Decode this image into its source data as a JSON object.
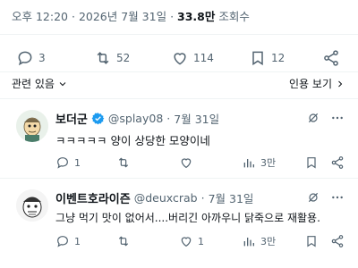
{
  "tweet_meta": {
    "time": "오후 12:20",
    "sep1": "·",
    "date": "2026년 7월 31일",
    "sep2": "·",
    "views": "33.8만",
    "views_label": "조회수"
  },
  "main_actions": {
    "reply_count": "3",
    "retweet_count": "52",
    "like_count": "114",
    "bookmark_count": "12"
  },
  "relevance": {
    "left_label": "관련 있음",
    "right_label": "인용 보기"
  },
  "replies": [
    {
      "name": "보더군",
      "handle": "@splay08",
      "sep": "·",
      "date": "7월 31일",
      "text": "ㅋㅋㅋㅋㅋ 양이 상당한 모양이네",
      "reply_count": "1",
      "views": "3만"
    },
    {
      "name": "이벤트호라이즌",
      "handle": "@deuxcrab",
      "sep": "·",
      "date": "7월 31일",
      "text": "그냥 먹기 맛이 없어서....버리긴 아까우니 닭죽으로 재활용.",
      "reply_count": "1",
      "like_count": "1",
      "views": "3만"
    }
  ],
  "colors": {
    "text": "#0f1419",
    "muted": "#536471",
    "verified": "#1d9bf0",
    "divider": "#eff3f4"
  }
}
